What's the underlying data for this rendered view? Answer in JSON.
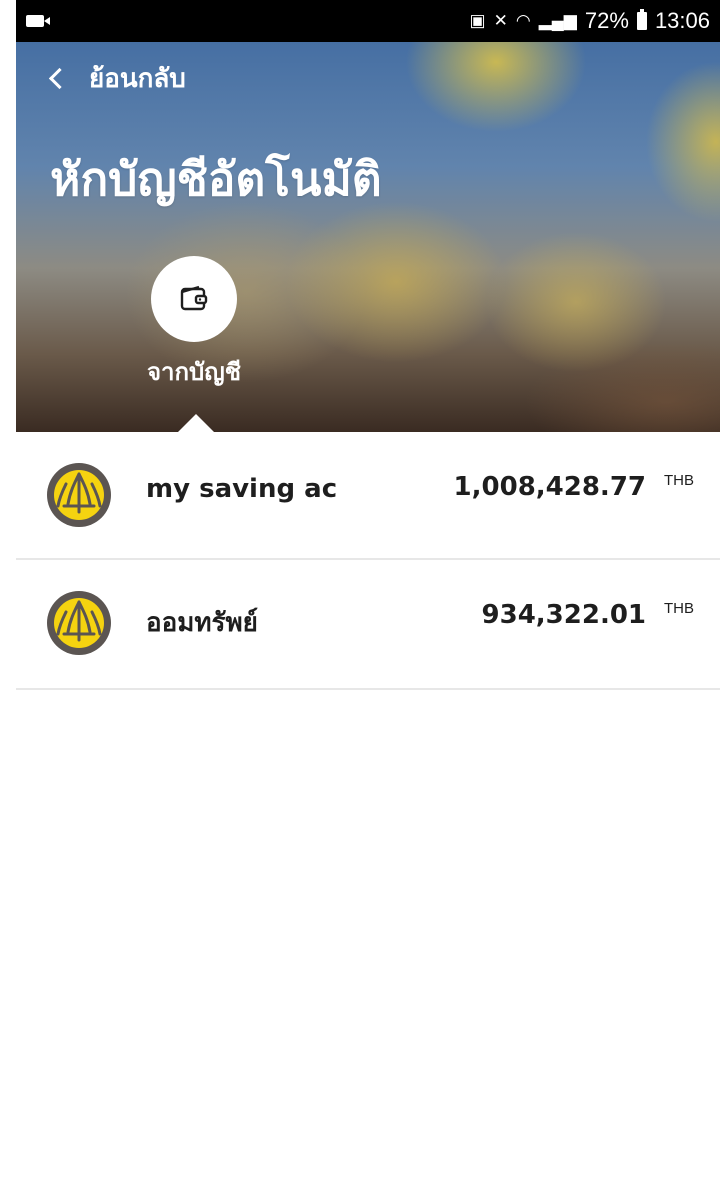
{
  "status_bar": {
    "battery": "72%",
    "time": "13:06"
  },
  "header": {
    "back_label": "ย้อนกลับ",
    "title": "หักบัญชีอัตโนมัติ",
    "source_tab_label": "จากบัญชี"
  },
  "accounts": [
    {
      "name": "my saving ac",
      "balance": "1,008,428.77",
      "currency": "THB"
    },
    {
      "name": "ออมทรัพย์",
      "balance": "934,322.01",
      "currency": "THB"
    }
  ],
  "colors": {
    "logo_ring": "#5b5552",
    "logo_fill": "#f5d310",
    "text": "#1e1e1e",
    "divider": "#e7e7e7"
  }
}
